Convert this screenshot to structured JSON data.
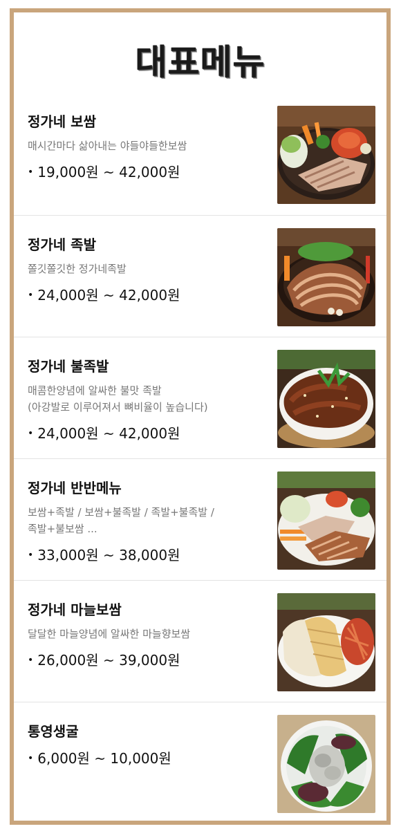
{
  "header": {
    "title": "대표메뉴"
  },
  "menu": [
    {
      "name": "정가네 보쌈",
      "desc": [
        "매시간마다 삶아내는 야들야들한보쌈"
      ],
      "price": "19,000원 ~ 42,000원",
      "photo_icon": "bossam-photo"
    },
    {
      "name": "정가네 족발",
      "desc": [
        "쫄깃쫄깃한 정가네족발"
      ],
      "price": "24,000원 ~ 42,000원",
      "photo_icon": "jokbal-photo"
    },
    {
      "name": "정가네 불족발",
      "desc": [
        "매콤한양념에 알싸한 불맛 족발",
        "(아강발로 이루어져서 뼈비율이 높습니다)"
      ],
      "price": "24,000원 ~ 42,000원",
      "photo_icon": "fire-jokbal-photo"
    },
    {
      "name": "정가네 반반메뉴",
      "desc": [
        "보쌈+족발 / 보쌈+불족발 / 족발+불족발 /",
        "족발+불보쌈 ..."
      ],
      "price": "33,000원 ~ 38,000원",
      "photo_icon": "half-half-photo"
    },
    {
      "name": "정가네 마늘보쌈",
      "desc": [
        "달달한 마늘양념에 알싸한 마늘향보쌈"
      ],
      "price": "26,000원 ~ 39,000원",
      "photo_icon": "garlic-bossam-photo"
    },
    {
      "name": "통영생굴",
      "desc": [],
      "price": "6,000원 ~ 10,000원",
      "photo_icon": "oyster-photo"
    }
  ],
  "colors": {
    "frame": "#c9a57c",
    "desc_text": "#777777",
    "divider": "#e3e3e3"
  }
}
